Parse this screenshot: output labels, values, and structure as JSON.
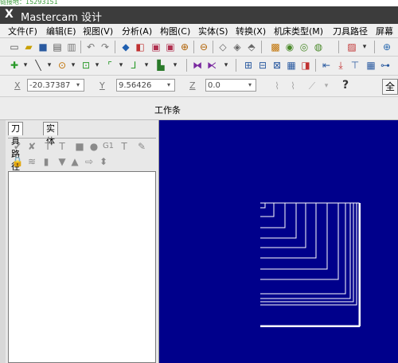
{
  "window": {
    "title": "Mastercam 设计",
    "logo_glyph": "X",
    "top_strip_text": "链接地：15293151"
  },
  "menubar": {
    "items": [
      "文件(F)",
      "编辑(E)",
      "视图(V)",
      "分析(A)",
      "构图(C)",
      "实体(S)",
      "转换(X)",
      "机床类型(M)",
      "刀具路径",
      "屏幕"
    ]
  },
  "coords": {
    "x_label": "X",
    "x_value": "-20.37387",
    "y_label": "Y",
    "y_value": "9.56426",
    "z_label": "Z",
    "z_value": "0.0",
    "help_glyph": "?",
    "right_button": "全"
  },
  "workbar": {
    "label": "工作条"
  },
  "left_panel": {
    "tabs": [
      "刀具路径",
      "实体"
    ],
    "ops_row1_icons": [
      "select-all-ops-icon",
      "select-failed-ops-icon",
      "regenerate-icon",
      "regenerate-dirty-icon",
      "backplot-icon",
      "verify-icon",
      "post-g1-icon",
      "high-speed-icon",
      "edit-icon"
    ],
    "ops_row2_icons": [
      "lock-icon",
      "toggle-display-icon",
      "posting-icon",
      "move-down-icon",
      "move-up-icon",
      "insert-arrow-icon",
      "scroll-icon"
    ]
  },
  "colors": {
    "viewport_bg": "#00008b",
    "geometry": "#ffffff",
    "title_bg": "#3c3c3c"
  }
}
